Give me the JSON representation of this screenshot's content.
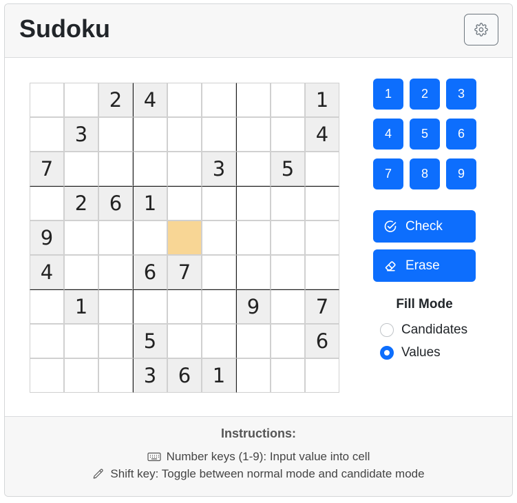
{
  "header": {
    "title": "Sudoku",
    "settings_icon": "gear-icon"
  },
  "board": {
    "cells": [
      [
        "",
        "",
        "2",
        "4",
        "",
        "",
        "",
        "",
        "1"
      ],
      [
        "",
        "3",
        "",
        "",
        "",
        "",
        "",
        "",
        "4"
      ],
      [
        "7",
        "",
        "",
        "",
        "",
        "3",
        "",
        "5",
        ""
      ],
      [
        "",
        "2",
        "6",
        "1",
        "",
        "",
        "",
        "",
        ""
      ],
      [
        "9",
        "",
        "",
        "",
        "",
        "",
        "",
        "",
        ""
      ],
      [
        "4",
        "",
        "",
        "6",
        "7",
        "",
        "",
        "",
        ""
      ],
      [
        "",
        "1",
        "",
        "",
        "",
        "",
        "9",
        "",
        "7"
      ],
      [
        "",
        "",
        "",
        "5",
        "",
        "",
        "",
        "",
        "6"
      ],
      [
        "",
        "",
        "",
        "3",
        "6",
        "1",
        "",
        "",
        ""
      ]
    ],
    "selected": {
      "row": 4,
      "col": 4
    },
    "colors": {
      "given_bg": "#efefef",
      "selected_bg": "#f8d695"
    }
  },
  "numpad": [
    "1",
    "2",
    "3",
    "4",
    "5",
    "6",
    "7",
    "8",
    "9"
  ],
  "actions": {
    "check_label": "Check",
    "check_icon": "check-circle-icon",
    "erase_label": "Erase",
    "erase_icon": "eraser-icon"
  },
  "fill_mode": {
    "label": "Fill Mode",
    "options": [
      {
        "label": "Candidates",
        "selected": false
      },
      {
        "label": "Values",
        "selected": true
      }
    ]
  },
  "instructions": {
    "title": "Instructions:",
    "lines": [
      {
        "icon": "keyboard-icon",
        "text": "Number keys (1-9): Input value into cell"
      },
      {
        "icon": "pencil-icon",
        "text": "Shift key: Toggle between normal mode and candidate mode"
      }
    ]
  },
  "colors": {
    "accent": "#0d6efd"
  }
}
